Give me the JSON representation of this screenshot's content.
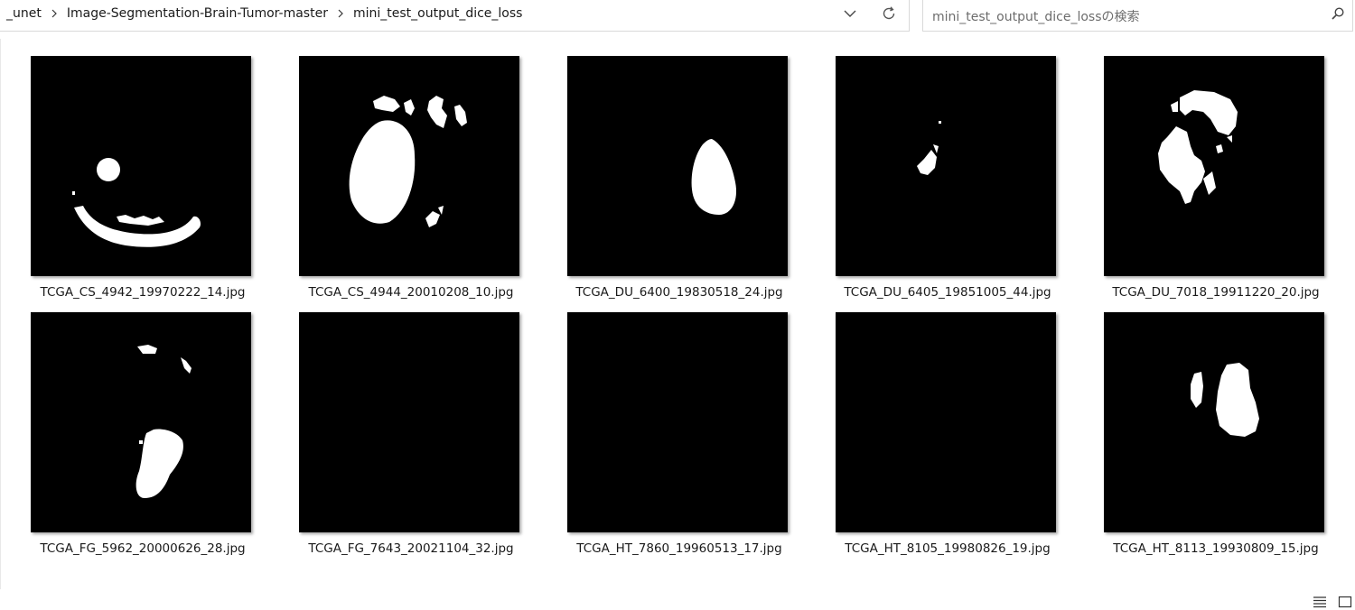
{
  "breadcrumb": {
    "items": [
      "_unet",
      "Image-Segmentation-Brain-Tumor-master",
      "mini_test_output_dice_loss"
    ]
  },
  "search": {
    "placeholder": "mini_test_output_dice_lossの検索"
  },
  "files": [
    {
      "name": "TCGA_CS_4942_19970222_14.jpg"
    },
    {
      "name": "TCGA_CS_4944_20010208_10.jpg"
    },
    {
      "name": "TCGA_DU_6400_19830518_24.jpg"
    },
    {
      "name": "TCGA_DU_6405_19851005_44.jpg"
    },
    {
      "name": "TCGA_DU_7018_19911220_20.jpg"
    },
    {
      "name": "TCGA_FG_5962_20000626_28.jpg"
    },
    {
      "name": "TCGA_FG_7643_20021104_32.jpg"
    },
    {
      "name": "TCGA_HT_7860_19960513_17.jpg"
    },
    {
      "name": "TCGA_HT_8105_19980826_19.jpg"
    },
    {
      "name": "TCGA_HT_8113_19930809_15.jpg"
    }
  ],
  "icons": {
    "dropdown": "chevron-down-icon",
    "refresh": "refresh-icon",
    "search": "search-icon",
    "details_view": "details-view-icon",
    "large_icons_view": "large-icons-view-icon"
  },
  "colors": {
    "mask_background": "#000000",
    "mask_foreground": "#ffffff"
  }
}
